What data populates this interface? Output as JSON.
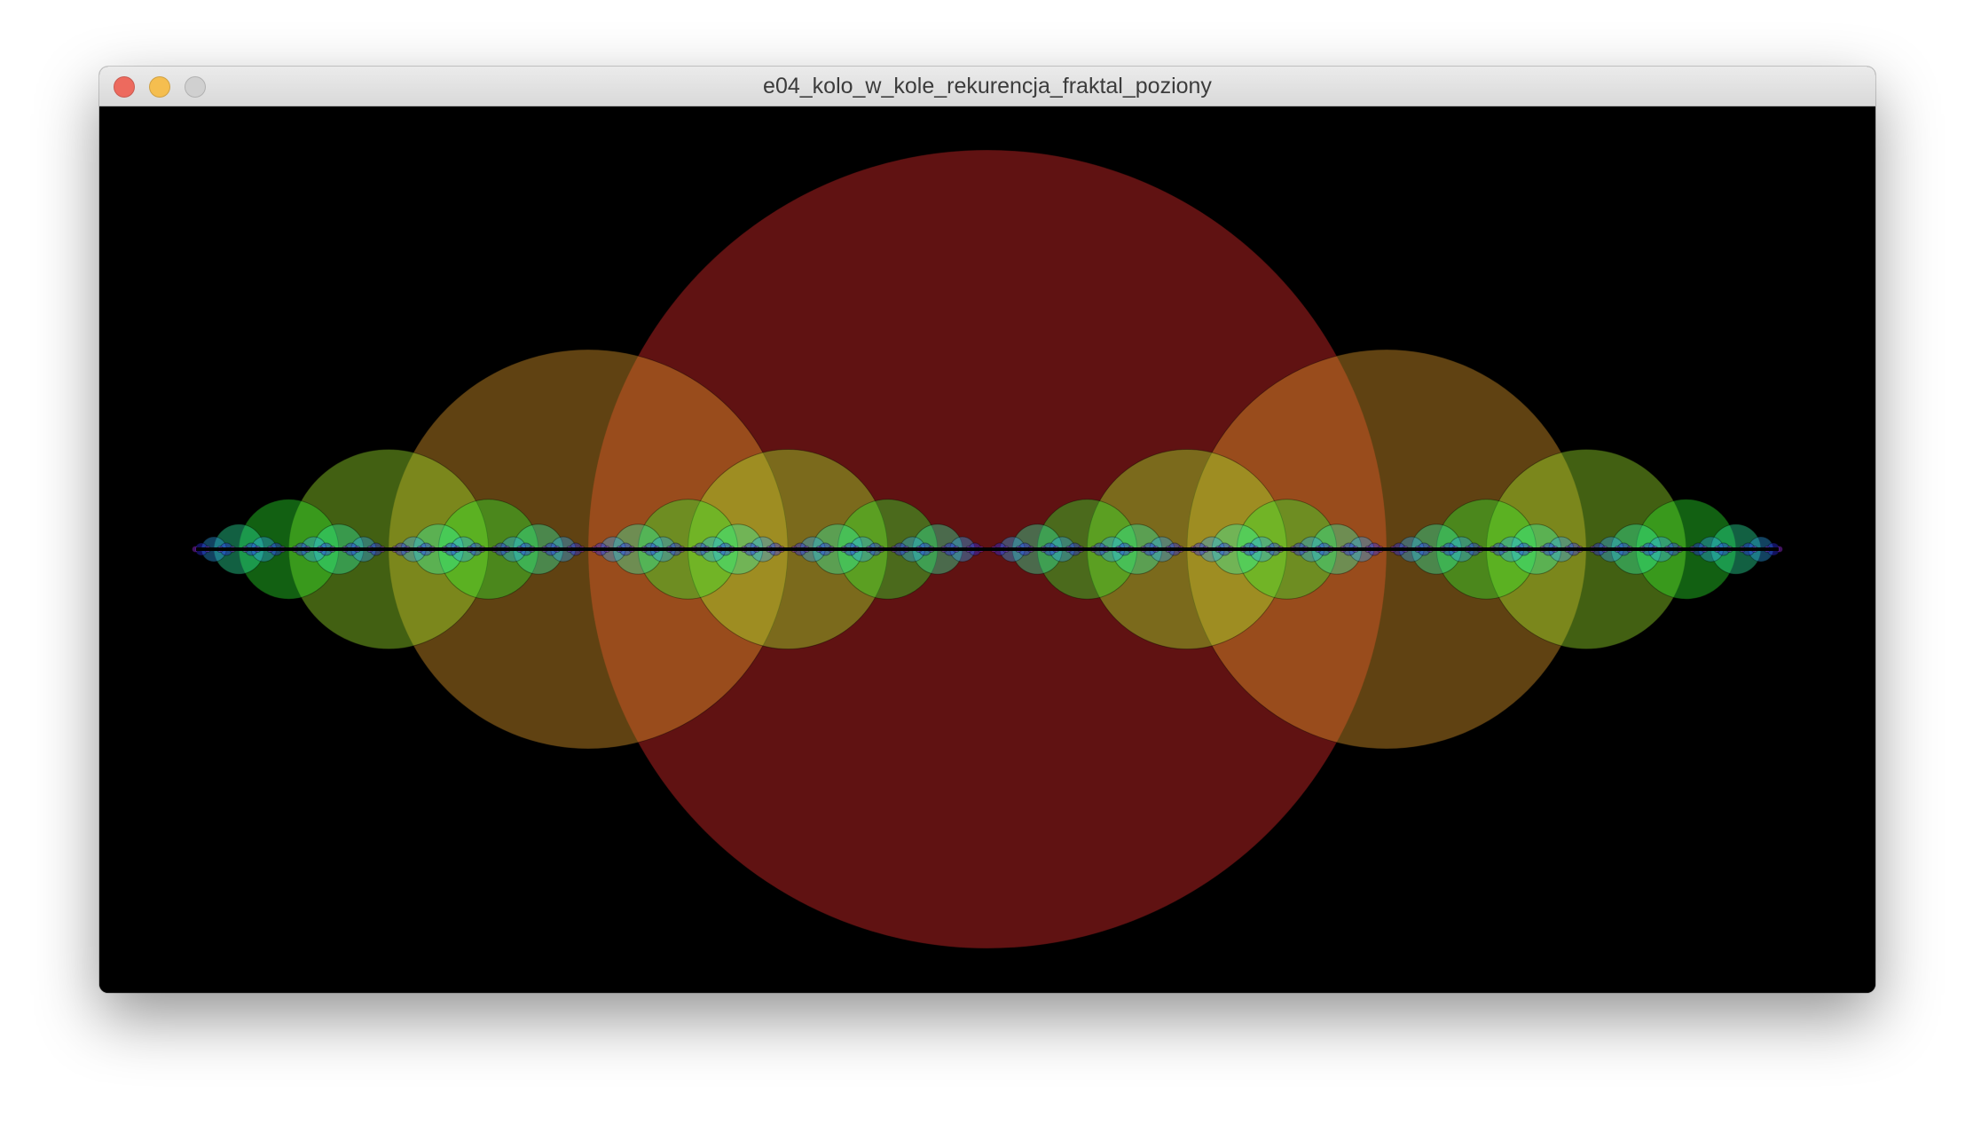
{
  "window": {
    "title": "e04_kolo_w_kole_rekurencja_fraktal_poziony",
    "buttons": {
      "close_color": "#ed6a5e",
      "minimize_color": "#f5be4f",
      "zoom_color": "#d0d0d0"
    }
  },
  "canvas": {
    "background": "#000000",
    "fractal": {
      "pattern": "circle-in-circle recursion, horizontal",
      "fill_opacity": 0.4,
      "colors": [
        "#f02d2d",
        "#f0a62d",
        "#a6f02d",
        "#2df02d",
        "#2df0a6",
        "#2da6f0",
        "#2d2df0",
        "#a62df0"
      ],
      "axis_line_color": "#000000"
    }
  }
}
